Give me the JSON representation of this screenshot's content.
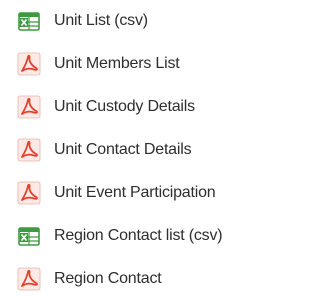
{
  "downloads": {
    "items": [
      {
        "label": "Unit List (csv)",
        "icon": "csv-file-icon"
      },
      {
        "label": "Unit Members List",
        "icon": "pdf-file-icon"
      },
      {
        "label": "Unit Custody Details",
        "icon": "pdf-file-icon"
      },
      {
        "label": "Unit Contact Details",
        "icon": "pdf-file-icon"
      },
      {
        "label": "Unit Event Participation",
        "icon": "pdf-file-icon"
      },
      {
        "label": "Region Contact list (csv)",
        "icon": "csv-file-icon"
      },
      {
        "label": "Region Contact",
        "icon": "pdf-file-icon"
      }
    ]
  },
  "colors": {
    "csv_icon_green": "#3f9a3f",
    "pdf_icon_red": "#e2412f",
    "text": "#2e2e2e"
  }
}
